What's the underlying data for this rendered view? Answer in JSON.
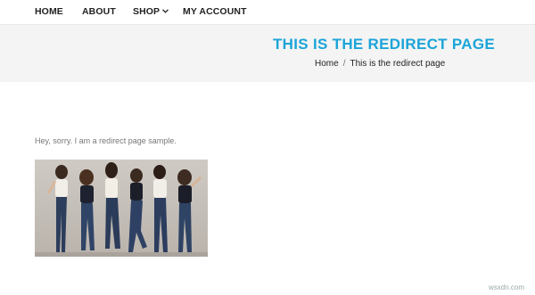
{
  "nav": {
    "home": "HOME",
    "about": "ABOUT",
    "shop": "SHOP",
    "account": "MY ACCOUNT"
  },
  "hero": {
    "title": "THIS IS THE REDIRECT PAGE",
    "breadcrumb_home": "Home",
    "breadcrumb_sep": "/",
    "breadcrumb_current": "This is the redirect page"
  },
  "content": {
    "text": "Hey, sorry. I am a redirect page sample.",
    "image_icon": "group-photo-image"
  },
  "watermark": "wsxdn.com",
  "colors": {
    "accent": "#1ba4d8",
    "band": "#f4f4f4"
  }
}
